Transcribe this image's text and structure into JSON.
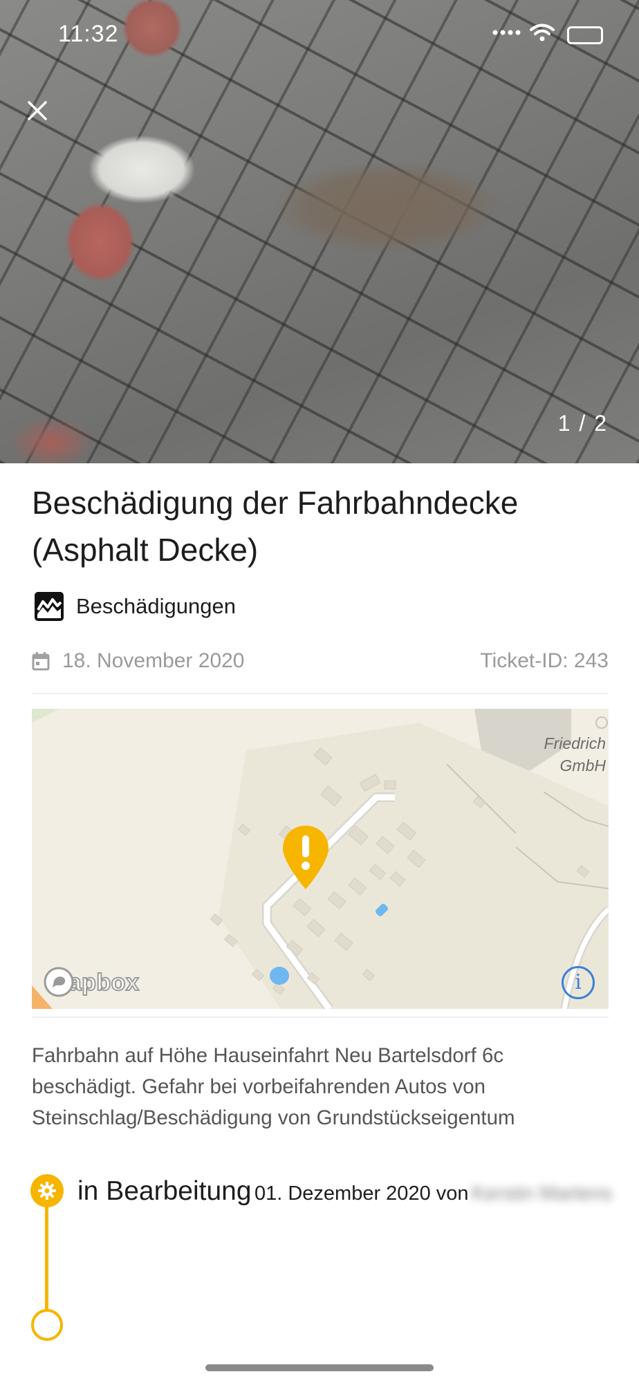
{
  "status_bar": {
    "time": "11:32"
  },
  "photo": {
    "page_indicator": "1 / 2"
  },
  "report": {
    "title": "Beschädigung der Fahrbahndecke (Asphalt Decke)",
    "category": "Beschädigungen",
    "date": "18. November 2020",
    "ticket_id": "Ticket-ID: 243",
    "description": "Fahrbahn auf Höhe Hauseinfahrt Neu Bartelsdorf 6c beschädigt. Gefahr bei vorbeifahrenden Autos von Steinschlag/Beschädigung von Grundstückseigentum"
  },
  "map": {
    "attribution_logo": "mapbox",
    "label_line1": "Friedrich",
    "label_line2": "GmbH",
    "info_button": "i",
    "marker_color": "#f7b500",
    "water_color": "#6fb7f0",
    "road_color": "#ffffff"
  },
  "timeline": {
    "status": "in Bearbeitung",
    "date": "01. Dezember 2020 von",
    "author": "Kerstin Martens",
    "accent_color": "#f7b500"
  }
}
